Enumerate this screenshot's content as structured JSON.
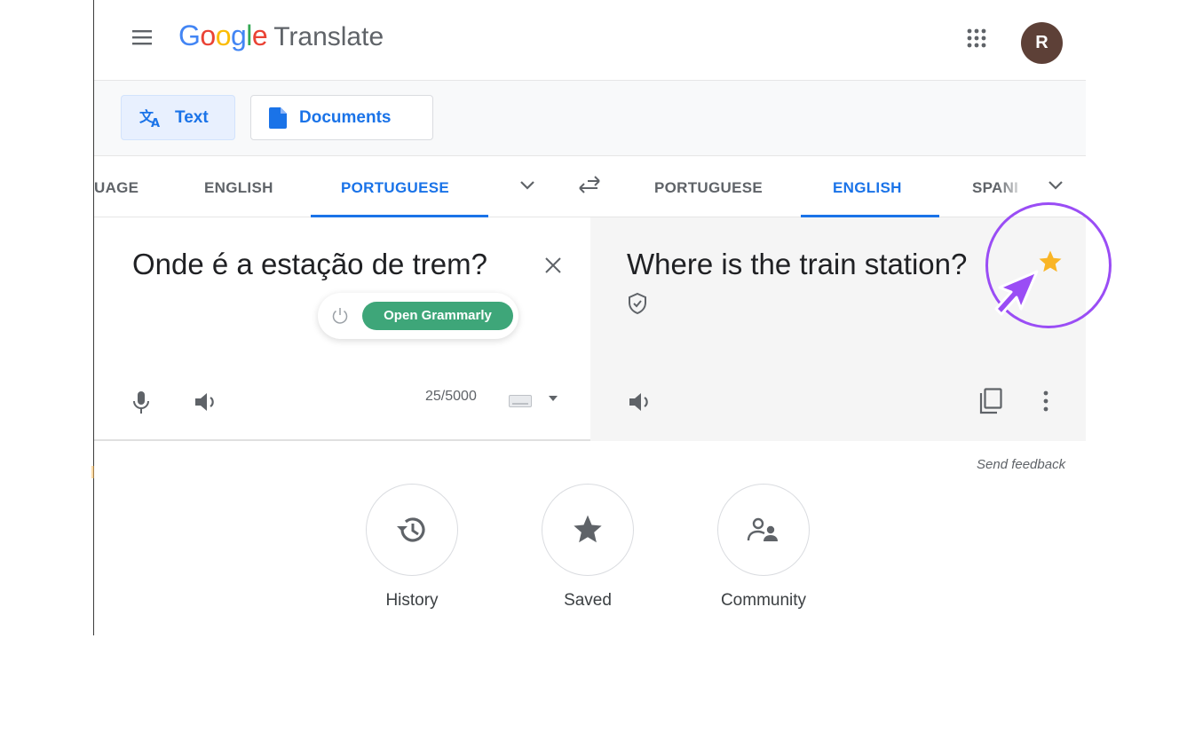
{
  "header": {
    "logo_letters": [
      "G",
      "o",
      "o",
      "g",
      "l",
      "e"
    ],
    "product": "Translate",
    "avatar_initial": "R"
  },
  "modes": {
    "text": "Text",
    "documents": "Documents"
  },
  "source_langs": [
    "UAGE",
    "ENGLISH",
    "PORTUGUESE"
  ],
  "target_langs": [
    "PORTUGUESE",
    "ENGLISH",
    "SPANI"
  ],
  "source": {
    "text": "Onde é a estação de trem?",
    "char_count": "25/5000"
  },
  "grammarly": {
    "button": "Open Grammarly"
  },
  "target": {
    "text": "Where is the train station?"
  },
  "feedback": "Send feedback",
  "actions": {
    "history": "History",
    "saved": "Saved",
    "community": "Community"
  },
  "colors": {
    "accent": "#1a73e8",
    "saved_star": "#f9b526",
    "annotation": "#9a4df5",
    "grammarly": "#3ea679",
    "avatar": "#5d4037"
  }
}
